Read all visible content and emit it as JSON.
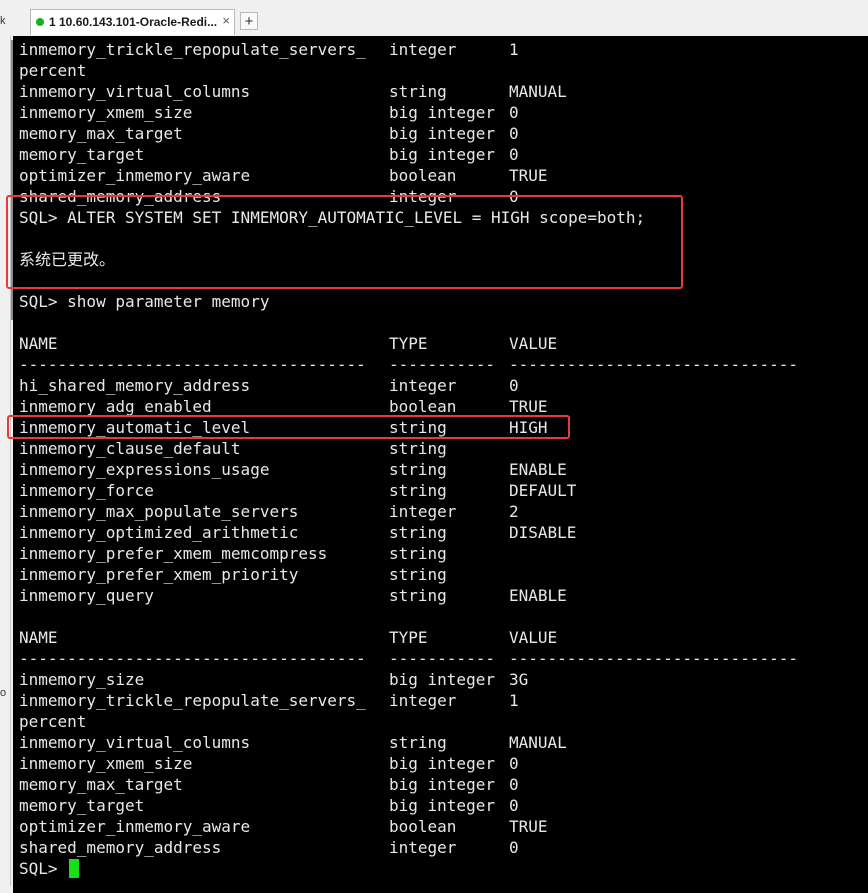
{
  "tab": {
    "title": "1 10.60.143.101-Oracle-Redi...",
    "close_symbol": "×",
    "add_symbol": "+"
  },
  "left_gutter": {
    "top_mark": "k",
    "mid_mark": "o"
  },
  "block1": [
    {
      "name": "inmemory_trickle_repopulate_servers_",
      "type": "integer",
      "value": "1"
    },
    {
      "name": "percent",
      "type": "",
      "value": ""
    },
    {
      "name": "inmemory_virtual_columns",
      "type": "string",
      "value": "MANUAL"
    },
    {
      "name": "inmemory_xmem_size",
      "type": "big integer",
      "value": "0"
    },
    {
      "name": "memory_max_target",
      "type": "big integer",
      "value": "0"
    },
    {
      "name": "memory_target",
      "type": "big integer",
      "value": "0"
    },
    {
      "name": "optimizer_inmemory_aware",
      "type": "boolean",
      "value": "TRUE"
    },
    {
      "name": "shared_memory_address",
      "type": "integer",
      "value": "0"
    }
  ],
  "commands": {
    "alter_system": "SQL> ALTER SYSTEM SET INMEMORY_AUTOMATIC_LEVEL = HIGH scope=both;",
    "system_altered": "系统已更改。",
    "show_parameter": "SQL> show parameter memory",
    "final_prompt": "SQL> "
  },
  "headers": {
    "name": "NAME",
    "type": "TYPE",
    "value": "VALUE",
    "sep_name": "------------------------------------",
    "sep_type": "-----------",
    "sep_value": "------------------------------"
  },
  "block2": [
    {
      "name": "hi_shared_memory_address",
      "type": "integer",
      "value": "0"
    },
    {
      "name": "inmemory_adg_enabled",
      "type": "boolean",
      "value": "TRUE"
    },
    {
      "name": "inmemory_automatic_level",
      "type": "string",
      "value": "HIGH"
    },
    {
      "name": "inmemory_clause_default",
      "type": "string",
      "value": ""
    },
    {
      "name": "inmemory_expressions_usage",
      "type": "string",
      "value": "ENABLE"
    },
    {
      "name": "inmemory_force",
      "type": "string",
      "value": "DEFAULT"
    },
    {
      "name": "inmemory_max_populate_servers",
      "type": "integer",
      "value": "2"
    },
    {
      "name": "inmemory_optimized_arithmetic",
      "type": "string",
      "value": "DISABLE"
    },
    {
      "name": "inmemory_prefer_xmem_memcompress",
      "type": "string",
      "value": ""
    },
    {
      "name": "inmemory_prefer_xmem_priority",
      "type": "string",
      "value": ""
    },
    {
      "name": "inmemory_query",
      "type": "string",
      "value": "ENABLE"
    }
  ],
  "block3": [
    {
      "name": "inmemory_size",
      "type": "big integer",
      "value": "3G"
    },
    {
      "name": "inmemory_trickle_repopulate_servers_",
      "type": "integer",
      "value": "1"
    },
    {
      "name": "percent",
      "type": "",
      "value": ""
    },
    {
      "name": "inmemory_virtual_columns",
      "type": "string",
      "value": "MANUAL"
    },
    {
      "name": "inmemory_xmem_size",
      "type": "big integer",
      "value": "0"
    },
    {
      "name": "memory_max_target",
      "type": "big integer",
      "value": "0"
    },
    {
      "name": "memory_target",
      "type": "big integer",
      "value": "0"
    },
    {
      "name": "optimizer_inmemory_aware",
      "type": "boolean",
      "value": "TRUE"
    },
    {
      "name": "shared_memory_address",
      "type": "integer",
      "value": "0"
    }
  ],
  "colors": {
    "terminal_bg": "#000000",
    "terminal_text": "#e8e8e8",
    "highlight": "#e83a3a",
    "cursor": "#18e018",
    "tab_status": "#17b21c"
  }
}
